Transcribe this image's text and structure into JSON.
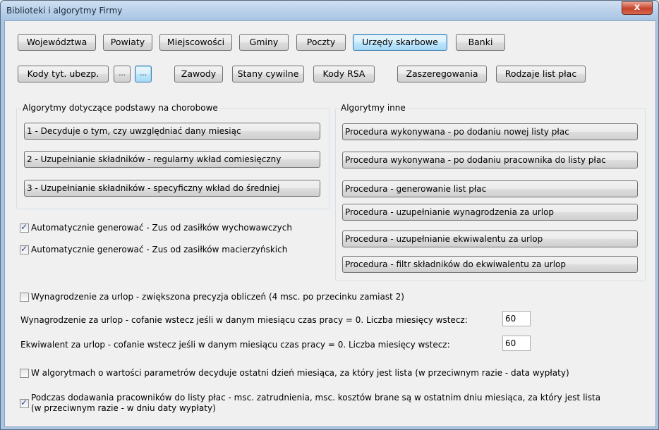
{
  "window": {
    "title": "Biblioteki i algorytmy Firmy",
    "close_glyph": "x"
  },
  "row1": {
    "buttons": [
      "Województwa",
      "Powiaty",
      "Miejscowości",
      "Gminy",
      "Poczty",
      "Urzędy skarbowe",
      "Banki"
    ],
    "selected": "Urzędy skarbowe"
  },
  "row2": {
    "buttons": [
      "Kody tyt. ubezp.",
      "...",
      "...",
      "Zawody",
      "Stany cywilne",
      "Kody RSA",
      "Zaszeregowania",
      "Rodzaje list płac"
    ]
  },
  "group_left": {
    "label": "Algorytmy dotyczące podstawy na chorobowe",
    "buttons": [
      "1 - Decyduje o tym, czy uwzględniać dany miesiąc",
      "2 - Uzupełnianie składników - regularny wkład comiesięczny",
      "3 - Uzupełnianie składników - specyficzny wkład do średniej"
    ]
  },
  "group_right": {
    "label": "Algorytmy inne",
    "buttons": [
      "Procedura wykonywana - po dodaniu nowej listy płac",
      "Procedura wykonywana - po dodaniu pracownika do listy płac",
      "Procedura - generowanie list płac",
      "Procedura - uzupełnianie wynagrodzenia za urlop",
      "Procedura - uzupełnianie ekwiwalentu za urlop",
      "Procedura - filtr składników do ekwiwalentu za urlop"
    ]
  },
  "checkboxes": {
    "auto_wych": {
      "label": "Automatycznie generować - Zus od zasiłków wychowawczych",
      "checked": true
    },
    "auto_macierz": {
      "label": "Automatycznie generować - Zus od zasiłków macierzyńskich",
      "checked": true
    },
    "precyzja": {
      "label": "Wynagrodzenie za urlop - zwiększona precyzja obliczeń (4 msc. po przecinku zamiast 2)",
      "checked": false
    },
    "ostatni_dzien": {
      "label": "W algorytmach o wartości parametrów decyduje ostatni dzień miesiąca, za który jest lista (w przeciwnym razie - data wypłaty)",
      "checked": false
    },
    "dodawanie": {
      "label_line1": "Podczas dodawania pracowników do listy płac - msc. zatrudnienia, msc. kosztów brane są w ostatnim dniu miesiąca, za który jest lista",
      "label_line2": "(w przeciwnym razie - w dniu daty wypłaty)",
      "checked": true
    }
  },
  "fields": {
    "wynagrodzenie": {
      "label": "Wynagrodzenie za urlop - cofanie wstecz jeśli w danym miesiącu czas pracy = 0. Liczba miesięcy  wstecz:",
      "value": "60"
    },
    "ekwiwalent": {
      "label": "Ekwiwalent za urlop - cofanie wstecz jeśli w danym miesiącu czas pracy = 0. Liczba miesięcy wstecz:",
      "value": "60"
    }
  },
  "check_glyph": "✓"
}
